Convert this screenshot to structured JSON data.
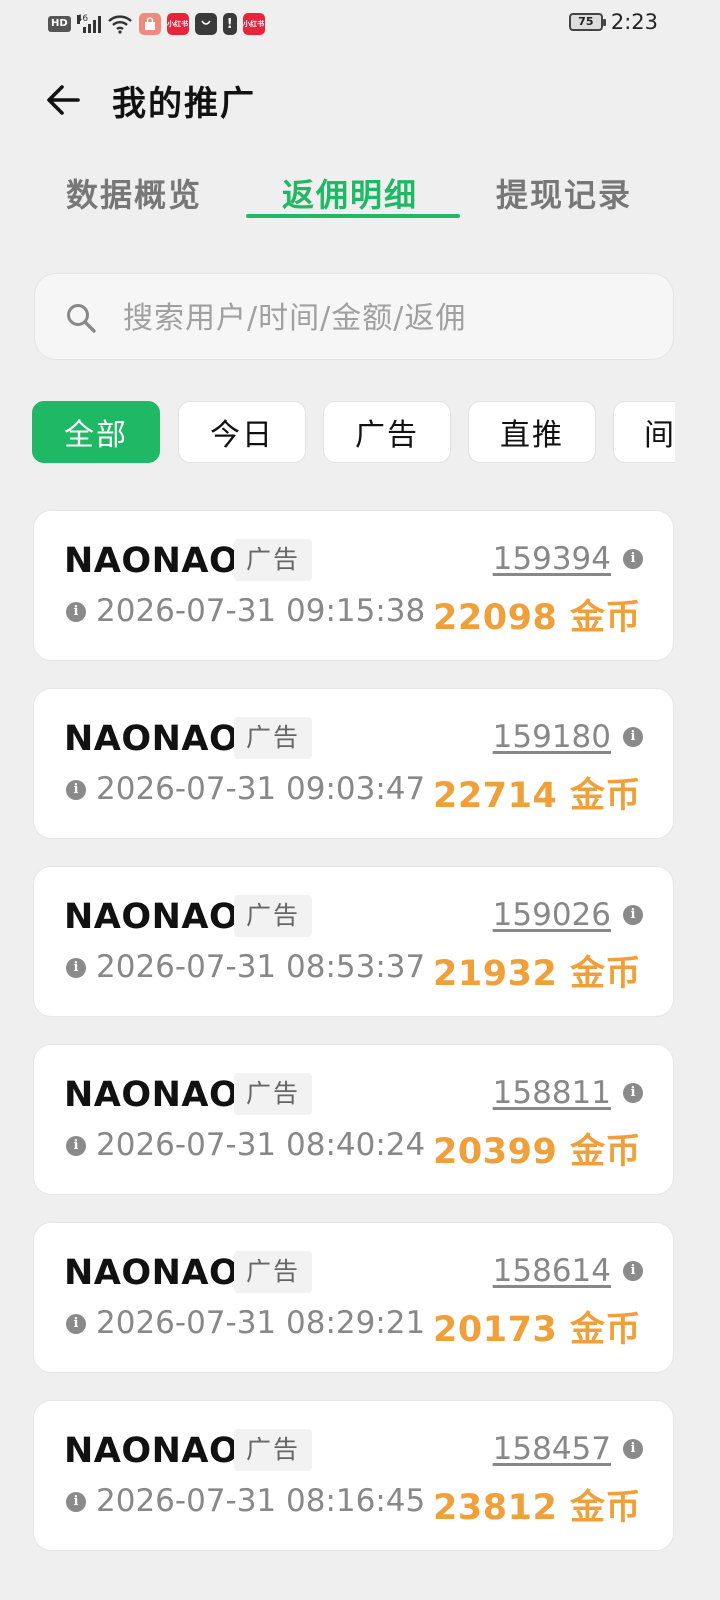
{
  "status_bar": {
    "network": "HD",
    "signal_label": "46",
    "app_badge": "小红书",
    "battery": "75",
    "time": "2:23"
  },
  "header": {
    "title": "我的推广"
  },
  "tabs": [
    {
      "label": "数据概览",
      "active": false
    },
    {
      "label": "返佣明细",
      "active": true
    },
    {
      "label": "提现记录",
      "active": false
    }
  ],
  "search": {
    "placeholder": "搜索用户/时间/金额/返佣"
  },
  "filters": [
    {
      "label": "全部",
      "active": true
    },
    {
      "label": "今日",
      "active": false
    },
    {
      "label": "广告",
      "active": false
    },
    {
      "label": "直推",
      "active": false
    },
    {
      "label": "间",
      "active": false
    }
  ],
  "records": [
    {
      "user": "NAONAO",
      "type": "广告",
      "time": "2026-07-31 09:15:38",
      "id": "159394",
      "amount": "22098 金币"
    },
    {
      "user": "NAONAO",
      "type": "广告",
      "time": "2026-07-31 09:03:47",
      "id": "159180",
      "amount": "22714 金币"
    },
    {
      "user": "NAONAO",
      "type": "广告",
      "time": "2026-07-31 08:53:37",
      "id": "159026",
      "amount": "21932 金币"
    },
    {
      "user": "NAONAO",
      "type": "广告",
      "time": "2026-07-31 08:40:24",
      "id": "158811",
      "amount": "20399 金币"
    },
    {
      "user": "NAONAO",
      "type": "广告",
      "time": "2026-07-31 08:29:21",
      "id": "158614",
      "amount": "20173 金币"
    },
    {
      "user": "NAONAO",
      "type": "广告",
      "time": "2026-07-31 08:16:45",
      "id": "158457",
      "amount": "23812 金币"
    }
  ],
  "colors": {
    "accent": "#1fb864",
    "amount": "#f0a03a",
    "background": "#efefef"
  }
}
